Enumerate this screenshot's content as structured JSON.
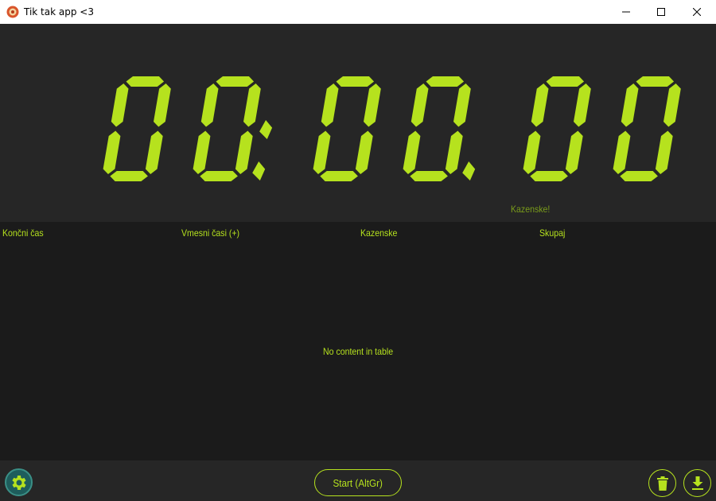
{
  "window": {
    "title": "Tik tak app <3"
  },
  "clock": {
    "display": "00:00.00",
    "penalty_label": "Kazenske!",
    "digit_color": "#b6e21e"
  },
  "table": {
    "columns": [
      "Končni čas",
      "Vmesni časi (+)",
      "Kazenske",
      "Skupaj"
    ],
    "empty_message": "No content in table"
  },
  "toolbar": {
    "start_label": "Start (AltGr)",
    "settings_icon": "gear-icon",
    "delete_icon": "trash-icon",
    "download_icon": "download-icon"
  },
  "colors": {
    "accent": "#b6e21e",
    "panel": "#262626",
    "background": "#1b1b1b",
    "settings": "#1e5d5c"
  }
}
